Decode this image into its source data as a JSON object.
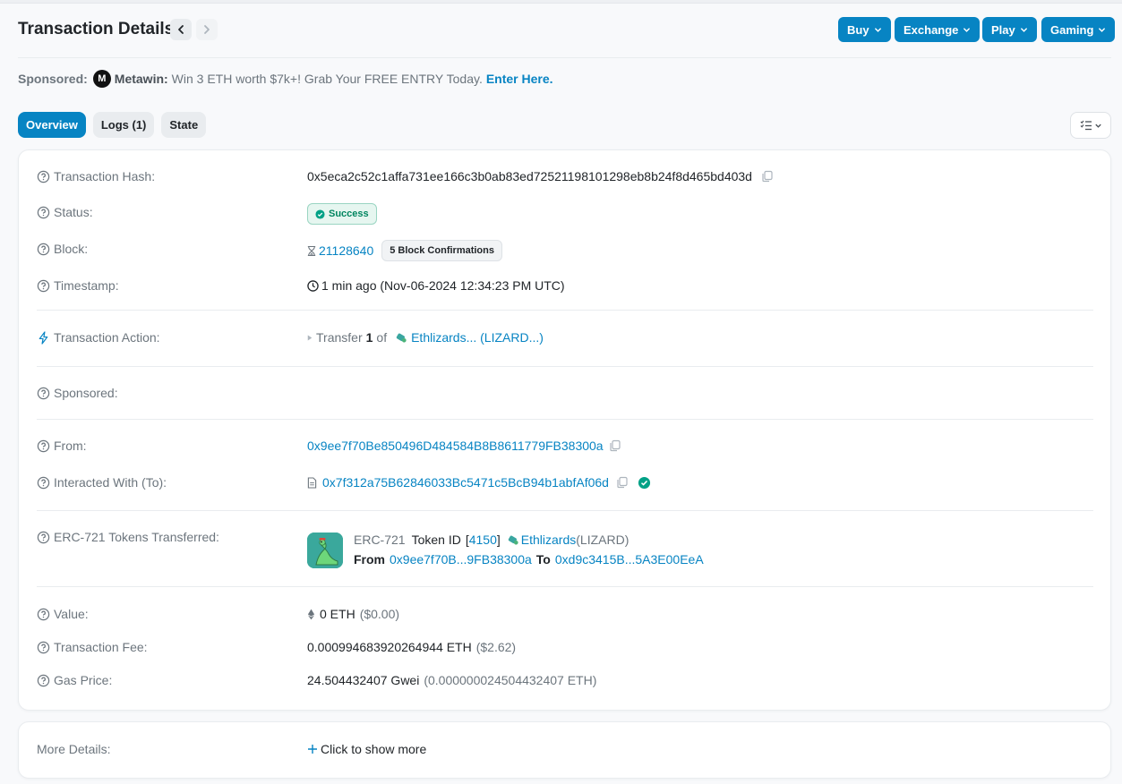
{
  "page": {
    "title": "Transaction Details"
  },
  "header_buttons": [
    {
      "label": "Buy"
    },
    {
      "label": "Exchange"
    },
    {
      "label": "Play"
    },
    {
      "label": "Gaming"
    }
  ],
  "sponsored_banner": {
    "label": "Sponsored:",
    "logo_letter": "M",
    "brand": "Metawin:",
    "text": "Win 3 ETH worth $7k+! Grab Your FREE ENTRY Today.",
    "cta": "Enter Here."
  },
  "tabs": [
    {
      "label": "Overview",
      "active": true
    },
    {
      "label": "Logs (1)",
      "active": false
    },
    {
      "label": "State",
      "active": false
    }
  ],
  "details": {
    "hash": {
      "label": "Transaction Hash:",
      "value": "0x5eca2c52c1affa731ee166c3b0ab83ed72521198101298eb8b24f8d465bd403d"
    },
    "status": {
      "label": "Status:",
      "value": "Success"
    },
    "block": {
      "label": "Block:",
      "value": "21128640",
      "confirmations": "5 Block Confirmations"
    },
    "timestamp": {
      "label": "Timestamp:",
      "value": "1 min ago (Nov-06-2024 12:34:23 PM UTC)"
    },
    "action": {
      "label": "Transaction Action:",
      "verb": "Transfer",
      "count": "1",
      "of": "of",
      "token": "Ethlizards... (LIZARD...)"
    },
    "sponsored": {
      "label": "Sponsored:"
    },
    "from": {
      "label": "From:",
      "value": "0x9ee7f70Be850496D484584B8B8611779FB38300a"
    },
    "to": {
      "label": "Interacted With (To):",
      "value": "0x7f312a75B62846033Bc5471c5BcB94b1abfAf06d"
    },
    "erc721": {
      "label": "ERC-721 Tokens Transferred:",
      "standard": "ERC-721",
      "token_id_label": "Token ID",
      "bracket_open": "[",
      "token_id": "4150",
      "bracket_close": "]",
      "token_name": "Ethlizards",
      "token_symbol": "(LIZARD)",
      "from_label": "From",
      "from_addr": "0x9ee7f70B...9FB38300a",
      "to_label": "To",
      "to_addr": "0xd9c3415B...5A3E00EeA"
    },
    "value": {
      "label": "Value:",
      "amount": "0 ETH",
      "usd": "($0.00)"
    },
    "fee": {
      "label": "Transaction Fee:",
      "amount": "0.000994683920264944 ETH",
      "usd": "($2.62)"
    },
    "gas": {
      "label": "Gas Price:",
      "amount": "24.504432407 Gwei",
      "eth": "(0.000000024504432407 ETH)"
    }
  },
  "more_details": {
    "label": "More Details:",
    "action": "Click to show more"
  },
  "colors": {
    "accent": "#0784c3",
    "success": "#00a186",
    "text_muted": "#6c757d"
  }
}
